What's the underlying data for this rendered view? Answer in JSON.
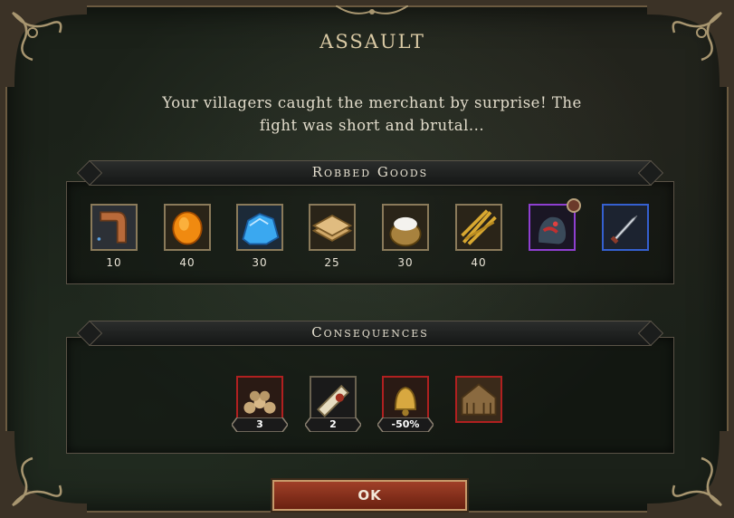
{
  "dialog": {
    "title": "ASSAULT",
    "description_line1": "Your villagers caught the merchant by surprise! The",
    "description_line2": "fight was short and brutal..."
  },
  "robbed_goods": {
    "header": "Robbed Goods",
    "items": [
      {
        "icon": "pipe-icon",
        "count": "10"
      },
      {
        "icon": "amber-coin-icon",
        "count": "40"
      },
      {
        "icon": "blue-crystal-icon",
        "count": "30"
      },
      {
        "icon": "wood-planks-icon",
        "count": "25"
      },
      {
        "icon": "flour-sack-icon",
        "count": "30"
      },
      {
        "icon": "wheat-bundle-icon",
        "count": "40"
      },
      {
        "icon": "creature-icon",
        "rarity": "epic"
      },
      {
        "icon": "dagger-icon",
        "rarity": "rare"
      }
    ]
  },
  "consequences": {
    "header": "Consequences",
    "items": [
      {
        "icon": "skulls-icon",
        "badge": "3"
      },
      {
        "icon": "scroll-icon",
        "badge": "2"
      },
      {
        "icon": "bell-icon",
        "badge": "-50%"
      },
      {
        "icon": "ruined-house-icon"
      }
    ]
  },
  "ok_label": "OK",
  "colors": {
    "title": "#d9c9a4",
    "epic_border": "#8e3fd0",
    "rare_border": "#3560d0",
    "danger_border": "#b02020",
    "button": "#a04028"
  }
}
